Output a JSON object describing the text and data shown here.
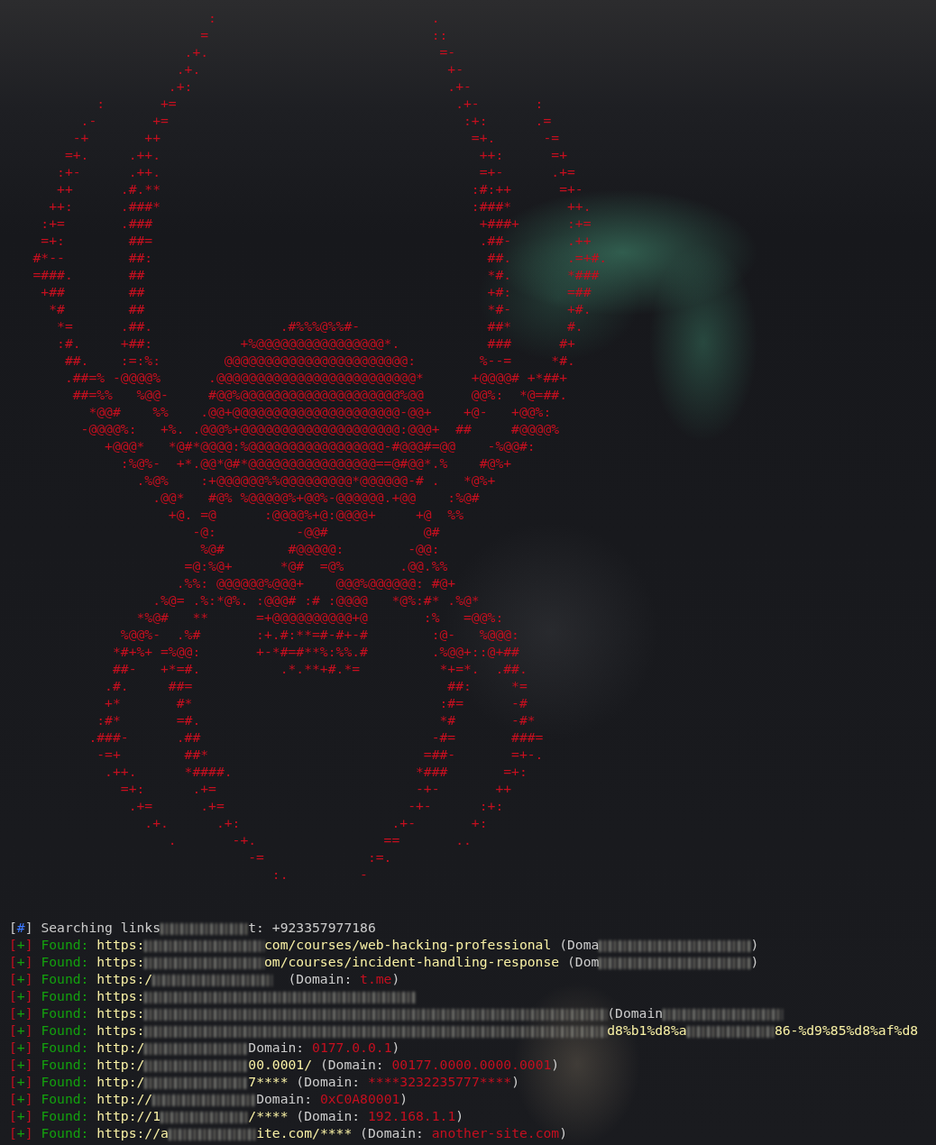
{
  "ascii_art": [
    "                         :                           .",
    "                        =                            ::",
    "                      .+.                             =-",
    "                     .+.                               +-",
    "                    .+:                                .+-",
    "           :       +=                                   .+-       :",
    "         .-       +=                                     :+:      .=",
    "        -+       ++                                       =+.      -=",
    "       =+.     .++.                                        ++:      =+",
    "      :+-      .++.                                        =+-      .+=",
    "      ++      .#.**                                       :#:++      =+-",
    "     ++:      .###*                                       :###*       ++.",
    "    :+=       .###                                         +###+      :+=",
    "    =+:        ##=                                         .##-       .++",
    "   #*--        ##:                                          ##.       .=+#.",
    "   =###.       ##                                           *#.       *###",
    "    +##        ##                                           +#:       =##",
    "     *#        ##                                           *#-       +#.",
    "      *=      .##.                .#%%%@%%#-                ##*       #.",
    "      :#.     +##:           +%@@@@@@@@@@@@@@@@*.           ###      #+",
    "       ##.    :=:%:        @@@@@@@@@@@@@@@@@@@@@@@:        %--=     *#.",
    "       .##=% -@@@@%      .@@@@@@@@@@@@@@@@@@@@@@@@@*      +@@@@# +*##+",
    "        ##=%%   %@@-     #@@%@@@@@@@@@@@@@@@@@@@@%@@      @@%:  *@=##.",
    "          *@@#    %%    .@@+@@@@@@@@@@@@@@@@@@@@@-@@+    +@-   +@@%:",
    "         -@@@@%:   +%. .@@@%+@@@@@@@@@@@@@@@@@@@@:@@@+  ##     #@@@@%",
    "            +@@@*   *@#*@@@@:%@@@@@@@@@@@@@@@@@-#@@@#=@@    -%@@#:",
    "              :%@%-  +*.@@*@#*@@@@@@@@@@@@@@@@==@#@@*.%    #@%+",
    "                .%@%    :+@@@@@@%%@@@@@@@@@*@@@@@@-# .   *@%+",
    "                  .@@*   #@% %@@@@@%+@@%-@@@@@@.+@@    :%@#",
    "                    +@. =@      :@@@@%+@:@@@@+     +@  %%",
    "                       -@:          -@@#            @#",
    "                        %@#        #@@@@@:        -@@:",
    "                      =@:%@+      *@#  =@%       .@@.%%",
    "                     .%%: @@@@@@%@@@+    @@@%@@@@@@: #@+",
    "                  .%@= .%:*@%. :@@@# :# :@@@@   *@%:#* .%@*",
    "                *%@#   **      =+@@@@@@@@@@+@       :%   =@@%:",
    "              %@@%-  .%#       :+.#:**=#-#+-#        :@-   %@@@:",
    "             *#+%+ =%@@:       +-*#=#**%:%%.#        .%@@+::@+##",
    "             ##-   +*=#.          .*.**+#.*=          *+=*.  .##.",
    "            .#.     ##=                                ##:     *=",
    "            +*       #*                               :#=      -#",
    "           :#*       =#.                              *#       -#*",
    "          .###-      .##                             -#=       ###=",
    "           -=+        ##*                           =##-       =+-.",
    "            .++.      *####.                       *###       =+:",
    "              =+:      .+=                         -+-       ++",
    "               .+=      .+=                       -+-      :+:",
    "                 .+.      .+:                   .+-       +:",
    "                    .       -+.                ==       ..",
    "                              -=             :=.",
    "                                 :.         -"
  ],
  "log": [
    {
      "kind": "info",
      "marker": {
        "open": "[",
        "symbol": "#",
        "close": "]"
      },
      "segments": [
        {
          "kind": "plain",
          "text": "Searching links"
        },
        {
          "kind": "tinyblur"
        },
        {
          "kind": "plain",
          "text": "t: +923357977186"
        }
      ]
    },
    {
      "kind": "found",
      "marker": {
        "open": "[",
        "symbol": "+",
        "close": "]"
      },
      "label": "Found:",
      "segments": [
        {
          "kind": "url",
          "text": "https:"
        },
        {
          "kind": "blur"
        },
        {
          "kind": "url",
          "text": "com/courses/web-hacking-professional"
        },
        {
          "kind": "plain",
          "text": " (Doma"
        },
        {
          "kind": "longblur"
        },
        {
          "kind": "plain",
          "text": ")"
        }
      ]
    },
    {
      "kind": "found",
      "marker": {
        "open": "[",
        "symbol": "+",
        "close": "]"
      },
      "label": "Found:",
      "segments": [
        {
          "kind": "url",
          "text": "https:"
        },
        {
          "kind": "blur"
        },
        {
          "kind": "url",
          "text": "om/courses/incident-handling-response"
        },
        {
          "kind": "plain",
          "text": " (Dom"
        },
        {
          "kind": "longblur"
        },
        {
          "kind": "plain",
          "text": ")"
        }
      ]
    },
    {
      "kind": "found",
      "marker": {
        "open": "[",
        "symbol": "+",
        "close": "]"
      },
      "label": "Found:",
      "segments": [
        {
          "kind": "url",
          "text": "https:/"
        },
        {
          "kind": "blur"
        },
        {
          "kind": "plain",
          "text": "  (Domain: "
        },
        {
          "kind": "value",
          "text": "t.me"
        },
        {
          "kind": "plain",
          "text": ")"
        }
      ]
    },
    {
      "kind": "found",
      "marker": {
        "open": "[",
        "symbol": "+",
        "close": "]"
      },
      "label": "Found:",
      "segments": [
        {
          "kind": "url",
          "text": "https:"
        },
        {
          "kind": "wideblur"
        }
      ]
    },
    {
      "kind": "found",
      "marker": {
        "open": "[",
        "symbol": "+",
        "close": "]"
      },
      "label": "Found:",
      "segments": [
        {
          "kind": "url",
          "text": "https:"
        },
        {
          "kind": "fullblur"
        },
        {
          "kind": "plain",
          "text": "(Domain"
        },
        {
          "kind": "blur"
        }
      ]
    },
    {
      "kind": "found",
      "marker": {
        "open": "[",
        "symbol": "+",
        "close": "]"
      },
      "label": "Found:",
      "segments": [
        {
          "kind": "url",
          "text": "https:"
        },
        {
          "kind": "fullblur"
        },
        {
          "kind": "url",
          "text": "d8%b1%d8%a"
        },
        {
          "kind": "tinyblur"
        },
        {
          "kind": "url",
          "text": "86-%d9%85%d8%af%d8"
        }
      ]
    },
    {
      "kind": "found",
      "marker": {
        "open": "[",
        "symbol": "+",
        "close": "]"
      },
      "label": "Found:",
      "segments": [
        {
          "kind": "url",
          "text": "http:/"
        },
        {
          "kind": "smallblur"
        },
        {
          "kind": "plain",
          "text": "Domain: "
        },
        {
          "kind": "value",
          "text": "0177.0.0.1"
        },
        {
          "kind": "plain",
          "text": ")"
        }
      ]
    },
    {
      "kind": "found",
      "marker": {
        "open": "[",
        "symbol": "+",
        "close": "]"
      },
      "label": "Found:",
      "segments": [
        {
          "kind": "url",
          "text": "http:/"
        },
        {
          "kind": "smallblur"
        },
        {
          "kind": "url",
          "text": "00.0001/"
        },
        {
          "kind": "plain",
          "text": " (Domain: "
        },
        {
          "kind": "value",
          "text": "00177.0000.0000.0001"
        },
        {
          "kind": "plain",
          "text": ")"
        }
      ]
    },
    {
      "kind": "found",
      "marker": {
        "open": "[",
        "symbol": "+",
        "close": "]"
      },
      "label": "Found:",
      "segments": [
        {
          "kind": "url",
          "text": "http:/"
        },
        {
          "kind": "smallblur"
        },
        {
          "kind": "url",
          "text": "7****"
        },
        {
          "kind": "plain",
          "text": " (Domain: "
        },
        {
          "kind": "value",
          "text": "****3232235777****"
        },
        {
          "kind": "plain",
          "text": ")"
        }
      ]
    },
    {
      "kind": "found",
      "marker": {
        "open": "[",
        "symbol": "+",
        "close": "]"
      },
      "label": "Found:",
      "segments": [
        {
          "kind": "url",
          "text": "http://"
        },
        {
          "kind": "smallblur"
        },
        {
          "kind": "plain",
          "text": "Domain: "
        },
        {
          "kind": "value",
          "text": "0xC0A80001"
        },
        {
          "kind": "plain",
          "text": ")"
        }
      ]
    },
    {
      "kind": "found",
      "marker": {
        "open": "[",
        "symbol": "+",
        "close": "]"
      },
      "label": "Found:",
      "segments": [
        {
          "kind": "url",
          "text": "http://1"
        },
        {
          "kind": "tinyblur"
        },
        {
          "kind": "url",
          "text": "/****"
        },
        {
          "kind": "plain",
          "text": " (Domain: "
        },
        {
          "kind": "value",
          "text": "192.168.1.1"
        },
        {
          "kind": "plain",
          "text": ")"
        }
      ]
    },
    {
      "kind": "found",
      "marker": {
        "open": "[",
        "symbol": "+",
        "close": "]"
      },
      "label": "Found:",
      "segments": [
        {
          "kind": "url",
          "text": "https://a"
        },
        {
          "kind": "tinyblur"
        },
        {
          "kind": "url",
          "text": "ite.com/****"
        },
        {
          "kind": "plain",
          "text": " (Domain: "
        },
        {
          "kind": "value",
          "text": "another-site.com"
        },
        {
          "kind": "plain",
          "text": ")"
        }
      ]
    }
  ]
}
